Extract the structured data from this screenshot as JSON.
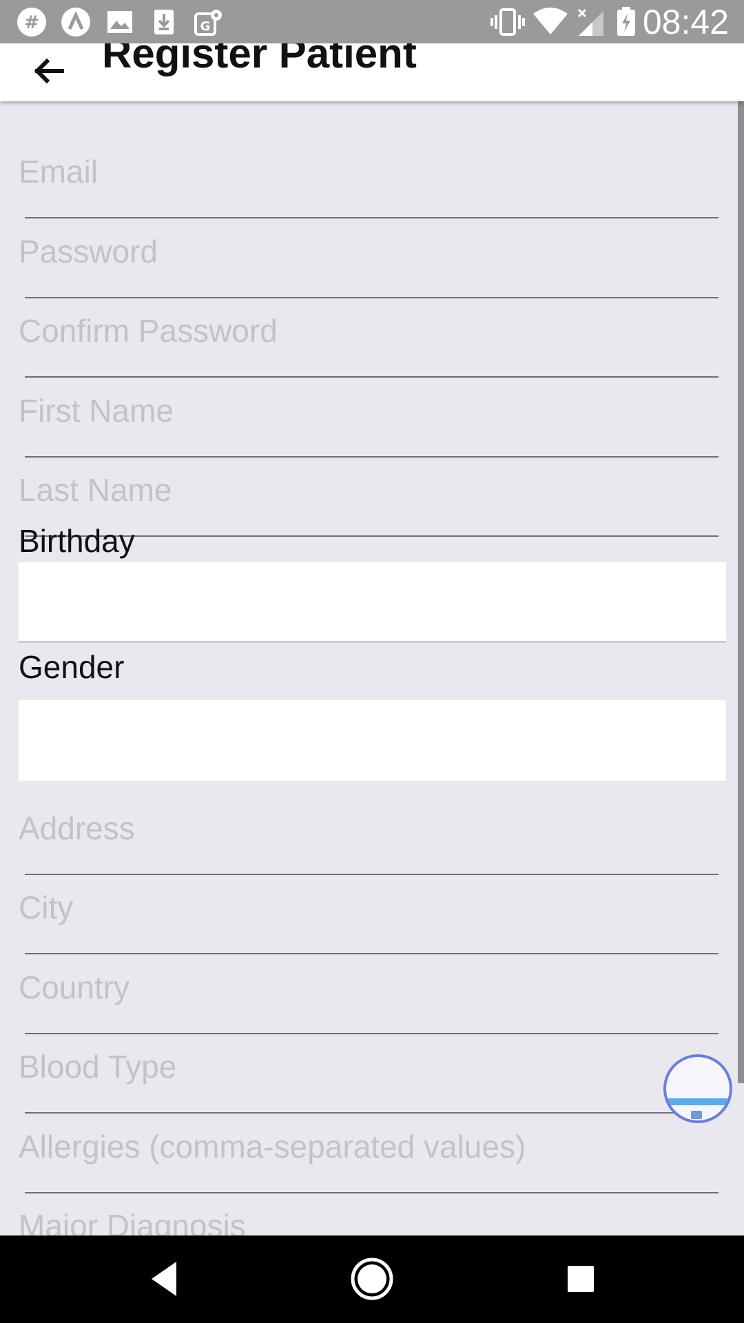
{
  "status_bar": {
    "time": "08:42",
    "left_icons": [
      "hashtag-icon",
      "arch-icon",
      "image-icon",
      "download-icon",
      "maps-icon"
    ],
    "right_icons": [
      "vibrate-icon",
      "wifi-icon",
      "signal-icon",
      "battery-icon"
    ]
  },
  "app_bar": {
    "title": "Register Patient",
    "back_icon": "arrow-back-icon"
  },
  "form": {
    "email_placeholder": "Email",
    "password_placeholder": "Password",
    "confirm_password_placeholder": "Confirm Password",
    "first_name_placeholder": "First Name",
    "last_name_placeholder": "Last Name",
    "birthday_label": "Birthday",
    "gender_label": "Gender",
    "address_placeholder": "Address",
    "city_placeholder": "City",
    "country_placeholder": "Country",
    "blood_type_placeholder": "Blood Type",
    "allergies_placeholder": "Allergies (comma-separated values)",
    "major_diagnosis_placeholder": "Major Diagnosis"
  },
  "nav_bar": {
    "buttons": [
      "back-triangle-icon",
      "home-circle-icon",
      "recents-square-icon"
    ]
  },
  "colors": {
    "background": "#e9e8ee",
    "status_bar": "#9a9a9a",
    "app_bar": "#ffffff",
    "placeholder": "#c3c2c6",
    "underline": "#6f6f73",
    "bubble_border": "#6a7de0"
  }
}
